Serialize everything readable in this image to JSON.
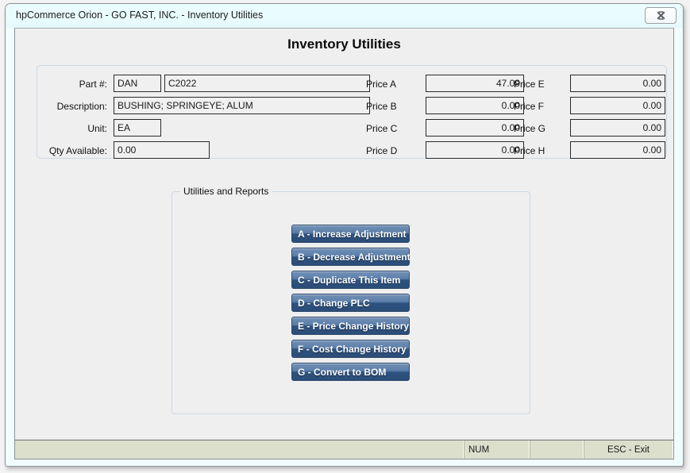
{
  "window": {
    "title": "hpCommerce Orion - GO FAST, INC. - Inventory Utilities",
    "close_label": "X",
    "close_icon": "close-x-icon"
  },
  "page": {
    "heading": "Inventory Utilities"
  },
  "info_panel": {
    "fields": [
      {
        "label": "Part #:",
        "value": "DAN"
      },
      {
        "label": "Description:",
        "value": "BUSHING; SPRINGEYE; ALUM"
      },
      {
        "label": "Unit:",
        "value": "EA"
      },
      {
        "label": "Qty Available:",
        "value": "0.00"
      }
    ],
    "part_number_suffix": "C2022",
    "prices_left": [
      {
        "label": "Price A",
        "value": "47.09"
      },
      {
        "label": "Price B",
        "value": "0.00"
      },
      {
        "label": "Price C",
        "value": "0.00"
      },
      {
        "label": "Price D",
        "value": "0.00"
      }
    ],
    "prices_right": [
      {
        "label": "Price E",
        "value": "0.00"
      },
      {
        "label": "Price F",
        "value": "0.00"
      },
      {
        "label": "Price G",
        "value": "0.00"
      },
      {
        "label": "Price H",
        "value": "0.00"
      }
    ]
  },
  "group": {
    "label": "Utilities and Reports",
    "buttons": [
      {
        "label": "A - Increase Adjustment"
      },
      {
        "label": "B - Decrease Adjustment"
      },
      {
        "label": "C - Duplicate This Item"
      },
      {
        "label": "D - Change PLC"
      },
      {
        "label": "E - Price Change History"
      },
      {
        "label": "F - Cost Change History"
      },
      {
        "label": "G - Convert to BOM"
      }
    ]
  },
  "statusbar": {
    "panels": [
      {
        "text": ""
      },
      {
        "text": "NUM"
      },
      {
        "text": ""
      },
      {
        "text": "ESC - Exit"
      }
    ]
  },
  "colors": {
    "button_top": "#7592b7",
    "button_bottom": "#2b4d78",
    "button_border": "#2e4a6b",
    "titlebar": "#eafdff",
    "client_bg": "#efefef",
    "statusbar_bg": "#dcdfcc",
    "panel_border": "#ccd8e2",
    "field_border": "#2a2a2a"
  }
}
